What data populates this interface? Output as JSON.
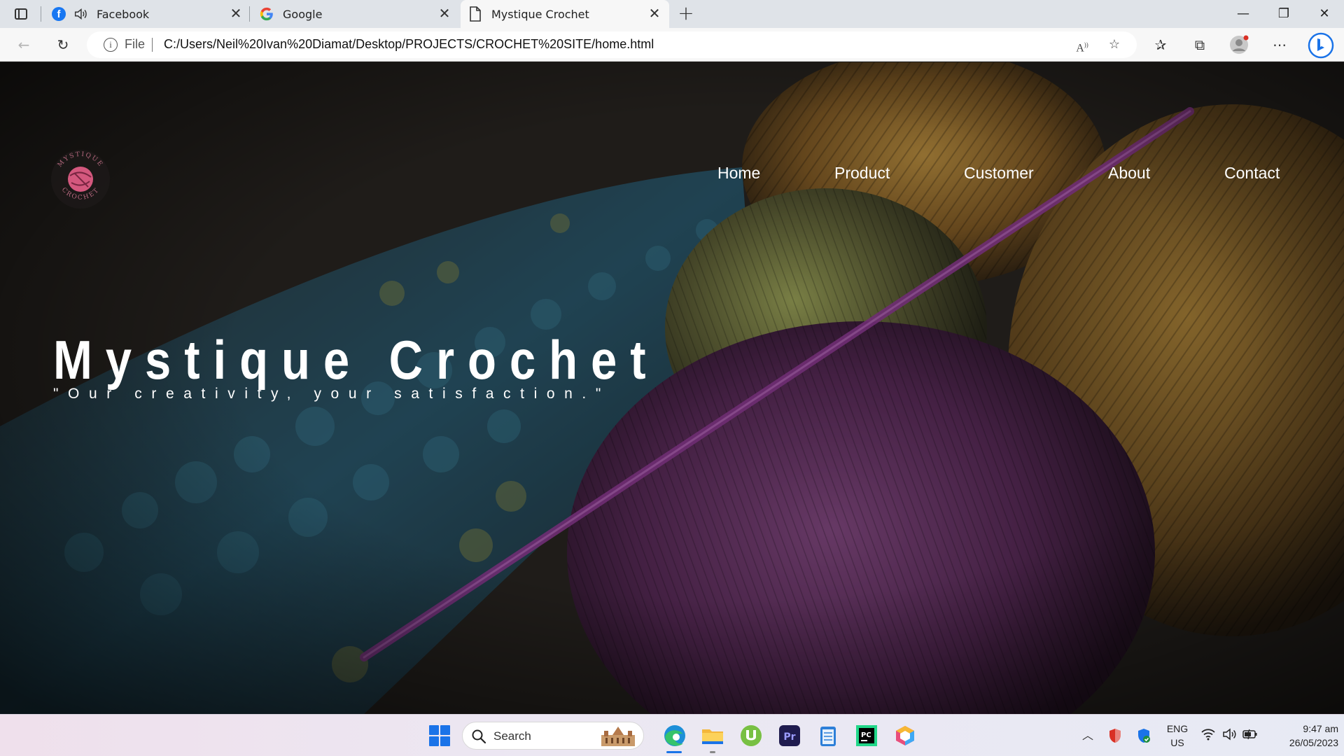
{
  "browser": {
    "tabs": [
      {
        "title": "Facebook",
        "icon": "facebook-icon",
        "audio_icon": "speaker-icon"
      },
      {
        "title": "Google",
        "icon": "google-icon"
      },
      {
        "title": "Mystique Crochet",
        "icon": "document-icon",
        "active": true
      }
    ],
    "address": {
      "scheme_label": "File",
      "url": "C:/Users/Neil%20Ivan%20Diamat/Desktop/PROJECTS/CROCHET%20SITE/home.html"
    }
  },
  "page": {
    "logo": {
      "text_top": "MYSTIQUE",
      "text_bottom": "CROCHET"
    },
    "nav": [
      "Home",
      "Product",
      "Customer",
      "About",
      "Contact"
    ],
    "hero": {
      "title": "Mystique Crochet",
      "subtitle": "\"Our creativity, your satisfaction.\""
    }
  },
  "taskbar": {
    "search_label": "Search",
    "pinned": [
      "edge-icon",
      "file-explorer-icon",
      "utorrent-icon",
      "premiere-pro-icon",
      "notepad-icon",
      "pycharm-icon",
      "app-cube-icon"
    ],
    "tray": {
      "language": "ENG",
      "region": "US",
      "time": "9:47 am",
      "date": "26/05/2023"
    }
  },
  "colors": {
    "edge_accent": "#1a73e8",
    "yarn_purple": "#7b3f78",
    "yarn_gold": "#b88a3a",
    "yarn_blue": "#2f5b73"
  }
}
